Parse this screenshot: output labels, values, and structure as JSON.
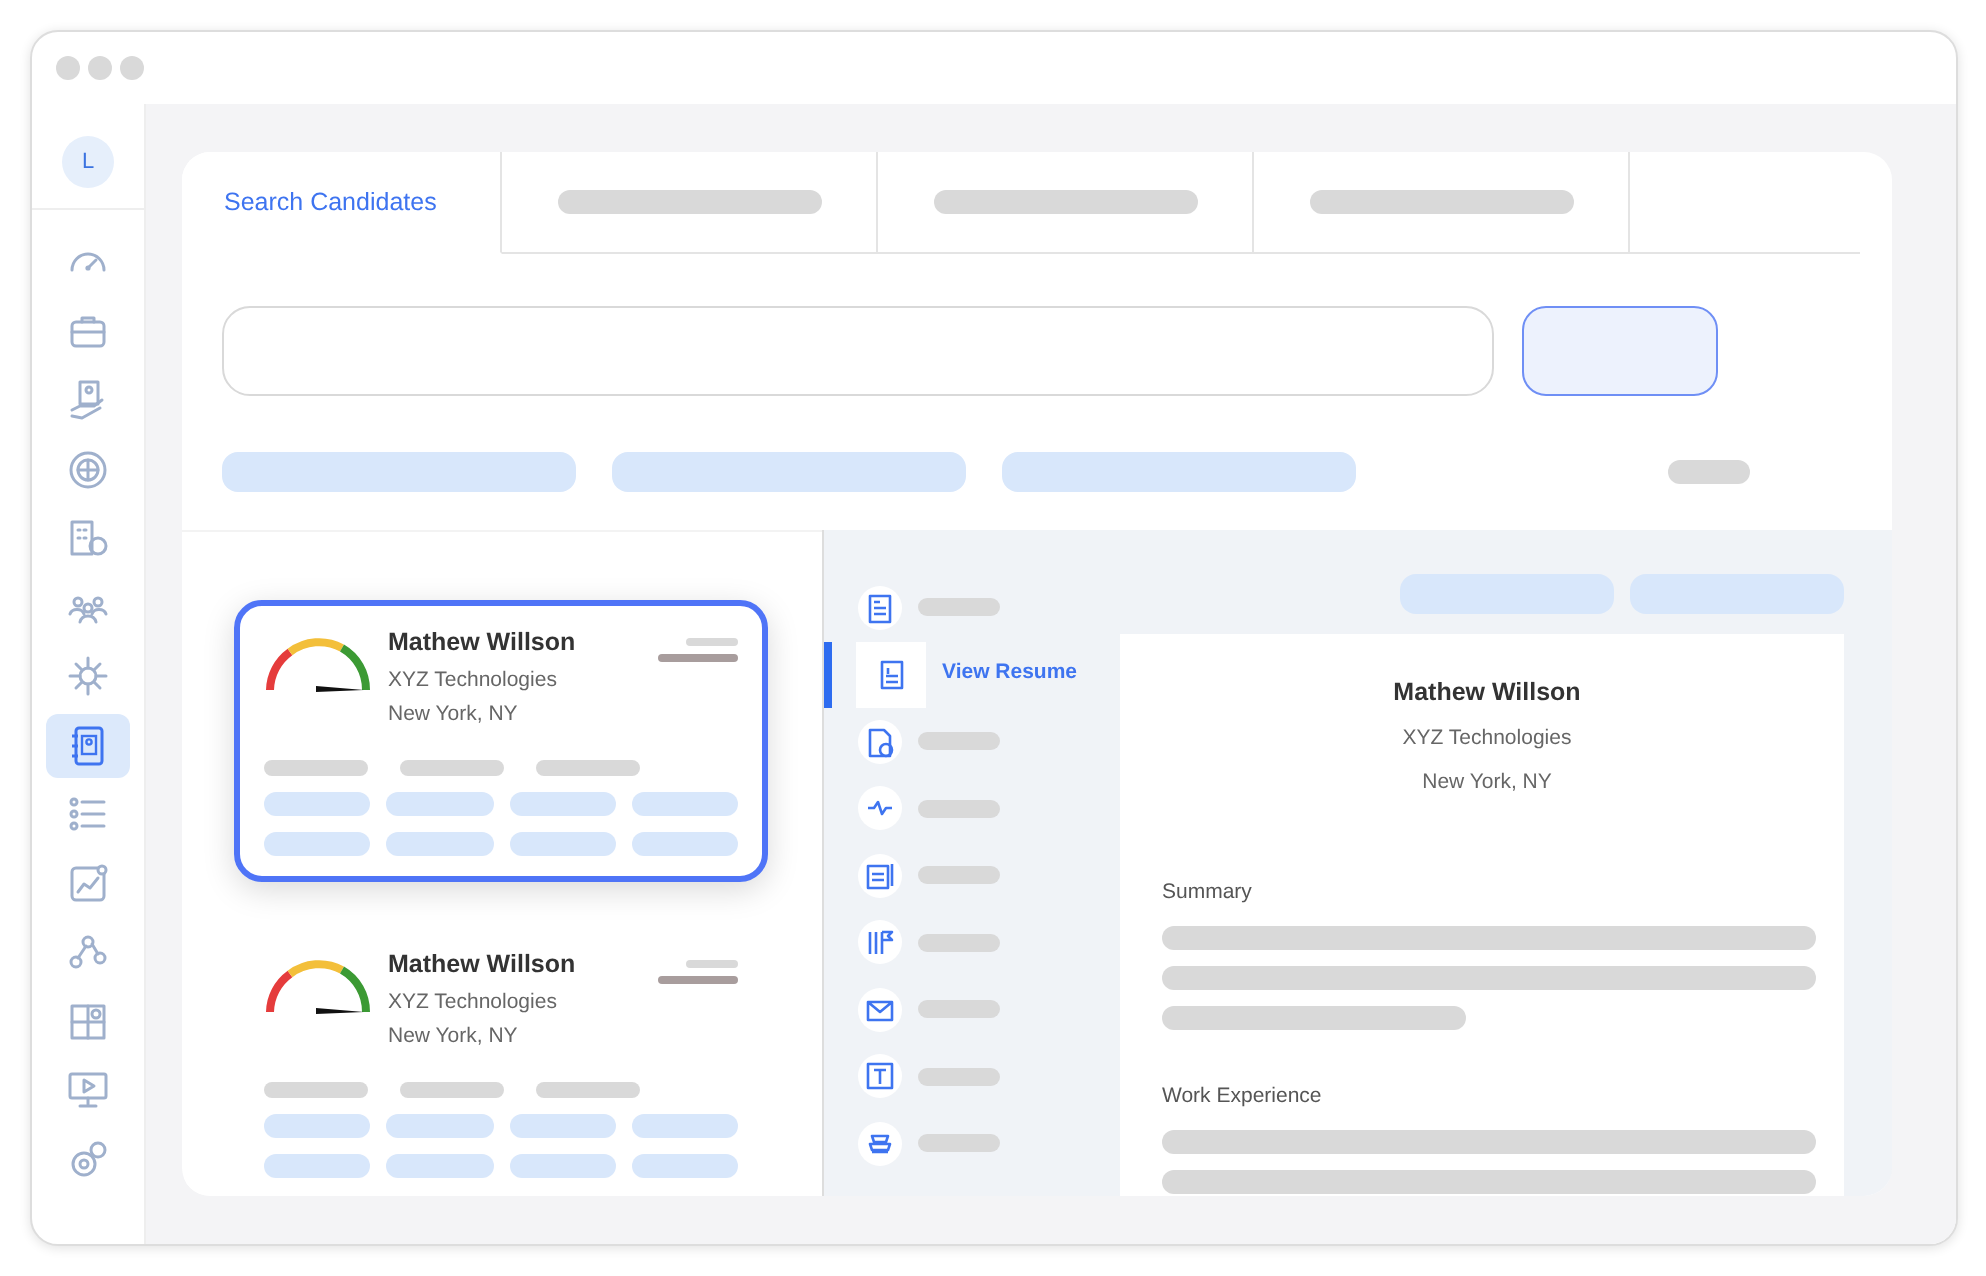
{
  "sidebar": {
    "avatar": "L",
    "items": [
      {
        "selected": false
      },
      {
        "selected": false
      },
      {
        "selected": false
      },
      {
        "selected": false
      },
      {
        "selected": false
      },
      {
        "selected": false
      },
      {
        "selected": false
      },
      {
        "selected": true
      },
      {
        "selected": false
      },
      {
        "selected": false
      },
      {
        "selected": false
      },
      {
        "selected": false
      },
      {
        "selected": false
      },
      {
        "selected": false
      }
    ]
  },
  "tabs": [
    {
      "label": "Search Candidates",
      "selected": true
    },
    {
      "selected": false
    },
    {
      "selected": false
    },
    {
      "selected": false
    }
  ],
  "candidates": [
    {
      "name": "Mathew Willson",
      "company": "XYZ Technologies",
      "location": "New York, NY",
      "selected": true
    },
    {
      "name": "Mathew Willson",
      "company": "XYZ Technologies",
      "location": "New York, NY",
      "selected": false
    }
  ],
  "resume_nav": [
    {
      "selected": false
    },
    {
      "label": "View Resume",
      "selected": true
    },
    {
      "selected": false
    },
    {
      "selected": false
    },
    {
      "selected": false
    },
    {
      "selected": false
    },
    {
      "selected": false
    },
    {
      "selected": false
    },
    {
      "selected": false
    }
  ],
  "resume": {
    "name": "Mathew Willson",
    "company": "XYZ Technologies",
    "location": "New York, NY",
    "sections": [
      {
        "title": "Summary"
      },
      {
        "title": "Work Experience"
      }
    ]
  }
}
